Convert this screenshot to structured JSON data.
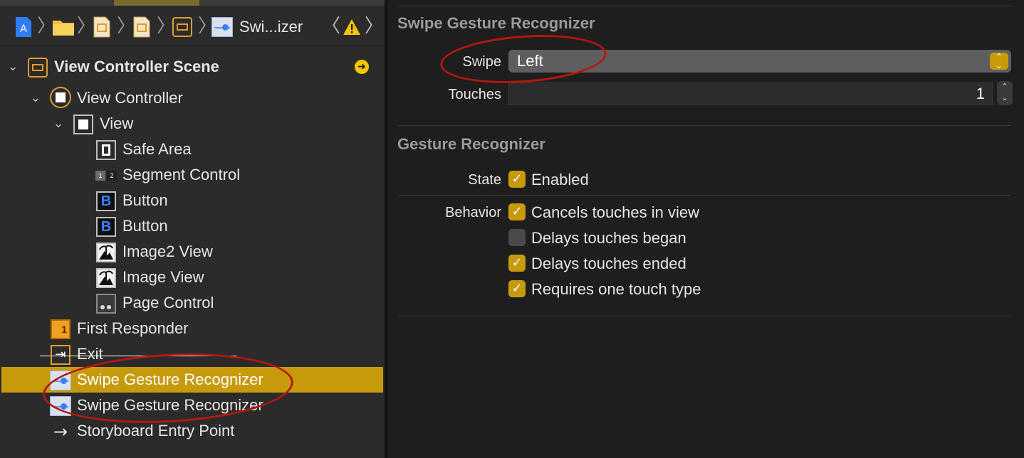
{
  "breadcrumb": {
    "items": [
      {
        "icon": "app-project-icon"
      },
      {
        "icon": "folder-icon"
      },
      {
        "icon": "storyboard-file-icon"
      },
      {
        "icon": "storyboard-icon"
      },
      {
        "icon": "scene-icon"
      },
      {
        "icon": "swipe-gesture-icon",
        "label": "Swi...izer"
      }
    ],
    "separator": "〉",
    "back": "〈",
    "forward": "〉",
    "warning_icon": "warning-icon"
  },
  "outline": {
    "scene": {
      "label": "View Controller Scene",
      "expanded": true
    },
    "rows": [
      {
        "label": "View Controller",
        "icon": "view-controller-icon",
        "depth": 1
      },
      {
        "label": "View",
        "icon": "view-icon",
        "depth": 2
      },
      {
        "label": "Safe Area",
        "icon": "safe-area-icon",
        "depth": 3
      },
      {
        "label": "Segment Control",
        "icon": "segmented-control-icon",
        "depth": 3
      },
      {
        "label": "Button",
        "icon": "button-icon",
        "depth": 3
      },
      {
        "label": "Button",
        "icon": "button-icon",
        "depth": 3
      },
      {
        "label": "Image2 View",
        "icon": "image-view-icon",
        "depth": 3
      },
      {
        "label": "Image View",
        "icon": "image-view-icon",
        "depth": 3
      },
      {
        "label": "Page Control",
        "icon": "page-control-icon",
        "depth": 3
      },
      {
        "label": "First Responder",
        "icon": "first-responder-icon",
        "depth": 1
      },
      {
        "label": "Exit",
        "icon": "exit-icon",
        "depth": 1
      },
      {
        "label": "Swipe Gesture Recognizer",
        "icon": "swipe-gesture-icon",
        "depth": 1,
        "selected": true
      },
      {
        "label": "Swipe Gesture Recognizer",
        "icon": "swipe-gesture-icon",
        "depth": 1
      },
      {
        "label": "Storyboard Entry Point",
        "icon": "entry-arrow-icon",
        "depth": 1
      }
    ]
  },
  "inspector": {
    "swipe_section": {
      "title": "Swipe Gesture Recognizer",
      "swipe_label": "Swipe",
      "swipe_value": "Left",
      "touches_label": "Touches",
      "touches_value": "1"
    },
    "gesture_section": {
      "title": "Gesture Recognizer",
      "state_label": "State",
      "enabled": {
        "label": "Enabled",
        "checked": true
      },
      "behavior_label": "Behavior",
      "behaviors": [
        {
          "label": "Cancels touches in view",
          "checked": true
        },
        {
          "label": "Delays touches began",
          "checked": false
        },
        {
          "label": "Delays touches ended",
          "checked": true
        },
        {
          "label": "Requires one touch type",
          "checked": true
        }
      ]
    }
  },
  "colors": {
    "accent": "#c79a0b",
    "annotation": "#b5170e",
    "sidebar_bg": "#2b2b2c",
    "inspector_bg": "#1e1e1e"
  }
}
